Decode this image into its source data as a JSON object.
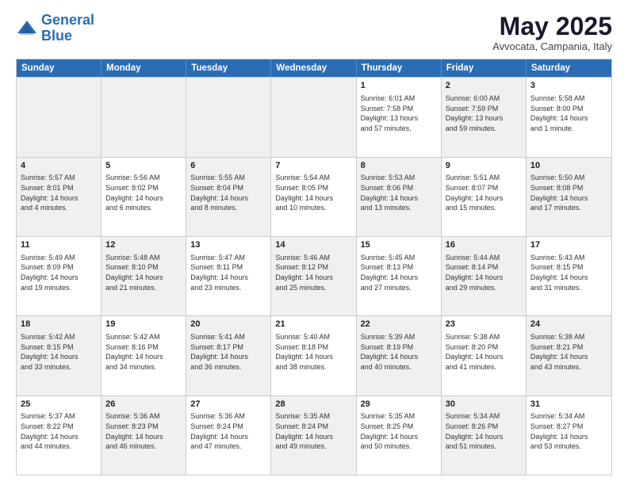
{
  "logo": {
    "line1": "General",
    "line2": "Blue"
  },
  "title": {
    "month_year": "May 2025",
    "location": "Avvocata, Campania, Italy"
  },
  "weekdays": [
    "Sunday",
    "Monday",
    "Tuesday",
    "Wednesday",
    "Thursday",
    "Friday",
    "Saturday"
  ],
  "rows": [
    [
      {
        "day": "",
        "info": "",
        "shaded": true
      },
      {
        "day": "",
        "info": "",
        "shaded": true
      },
      {
        "day": "",
        "info": "",
        "shaded": true
      },
      {
        "day": "",
        "info": "",
        "shaded": true
      },
      {
        "day": "1",
        "info": "Sunrise: 6:01 AM\nSunset: 7:58 PM\nDaylight: 13 hours\nand 57 minutes."
      },
      {
        "day": "2",
        "info": "Sunrise: 6:00 AM\nSunset: 7:59 PM\nDaylight: 13 hours\nand 59 minutes.",
        "shaded": true
      },
      {
        "day": "3",
        "info": "Sunrise: 5:58 AM\nSunset: 8:00 PM\nDaylight: 14 hours\nand 1 minute."
      }
    ],
    [
      {
        "day": "4",
        "info": "Sunrise: 5:57 AM\nSunset: 8:01 PM\nDaylight: 14 hours\nand 4 minutes.",
        "shaded": true
      },
      {
        "day": "5",
        "info": "Sunrise: 5:56 AM\nSunset: 8:02 PM\nDaylight: 14 hours\nand 6 minutes."
      },
      {
        "day": "6",
        "info": "Sunrise: 5:55 AM\nSunset: 8:04 PM\nDaylight: 14 hours\nand 8 minutes.",
        "shaded": true
      },
      {
        "day": "7",
        "info": "Sunrise: 5:54 AM\nSunset: 8:05 PM\nDaylight: 14 hours\nand 10 minutes."
      },
      {
        "day": "8",
        "info": "Sunrise: 5:53 AM\nSunset: 8:06 PM\nDaylight: 14 hours\nand 13 minutes.",
        "shaded": true
      },
      {
        "day": "9",
        "info": "Sunrise: 5:51 AM\nSunset: 8:07 PM\nDaylight: 14 hours\nand 15 minutes."
      },
      {
        "day": "10",
        "info": "Sunrise: 5:50 AM\nSunset: 8:08 PM\nDaylight: 14 hours\nand 17 minutes.",
        "shaded": true
      }
    ],
    [
      {
        "day": "11",
        "info": "Sunrise: 5:49 AM\nSunset: 8:09 PM\nDaylight: 14 hours\nand 19 minutes."
      },
      {
        "day": "12",
        "info": "Sunrise: 5:48 AM\nSunset: 8:10 PM\nDaylight: 14 hours\nand 21 minutes.",
        "shaded": true
      },
      {
        "day": "13",
        "info": "Sunrise: 5:47 AM\nSunset: 8:11 PM\nDaylight: 14 hours\nand 23 minutes."
      },
      {
        "day": "14",
        "info": "Sunrise: 5:46 AM\nSunset: 8:12 PM\nDaylight: 14 hours\nand 25 minutes.",
        "shaded": true
      },
      {
        "day": "15",
        "info": "Sunrise: 5:45 AM\nSunset: 8:13 PM\nDaylight: 14 hours\nand 27 minutes."
      },
      {
        "day": "16",
        "info": "Sunrise: 5:44 AM\nSunset: 8:14 PM\nDaylight: 14 hours\nand 29 minutes.",
        "shaded": true
      },
      {
        "day": "17",
        "info": "Sunrise: 5:43 AM\nSunset: 8:15 PM\nDaylight: 14 hours\nand 31 minutes."
      }
    ],
    [
      {
        "day": "18",
        "info": "Sunrise: 5:42 AM\nSunset: 8:15 PM\nDaylight: 14 hours\nand 33 minutes.",
        "shaded": true
      },
      {
        "day": "19",
        "info": "Sunrise: 5:42 AM\nSunset: 8:16 PM\nDaylight: 14 hours\nand 34 minutes."
      },
      {
        "day": "20",
        "info": "Sunrise: 5:41 AM\nSunset: 8:17 PM\nDaylight: 14 hours\nand 36 minutes.",
        "shaded": true
      },
      {
        "day": "21",
        "info": "Sunrise: 5:40 AM\nSunset: 8:18 PM\nDaylight: 14 hours\nand 38 minutes."
      },
      {
        "day": "22",
        "info": "Sunrise: 5:39 AM\nSunset: 8:19 PM\nDaylight: 14 hours\nand 40 minutes.",
        "shaded": true
      },
      {
        "day": "23",
        "info": "Sunrise: 5:38 AM\nSunset: 8:20 PM\nDaylight: 14 hours\nand 41 minutes."
      },
      {
        "day": "24",
        "info": "Sunrise: 5:38 AM\nSunset: 8:21 PM\nDaylight: 14 hours\nand 43 minutes.",
        "shaded": true
      }
    ],
    [
      {
        "day": "25",
        "info": "Sunrise: 5:37 AM\nSunset: 8:22 PM\nDaylight: 14 hours\nand 44 minutes."
      },
      {
        "day": "26",
        "info": "Sunrise: 5:36 AM\nSunset: 8:23 PM\nDaylight: 14 hours\nand 46 minutes.",
        "shaded": true
      },
      {
        "day": "27",
        "info": "Sunrise: 5:36 AM\nSunset: 8:24 PM\nDaylight: 14 hours\nand 47 minutes."
      },
      {
        "day": "28",
        "info": "Sunrise: 5:35 AM\nSunset: 8:24 PM\nDaylight: 14 hours\nand 49 minutes.",
        "shaded": true
      },
      {
        "day": "29",
        "info": "Sunrise: 5:35 AM\nSunset: 8:25 PM\nDaylight: 14 hours\nand 50 minutes."
      },
      {
        "day": "30",
        "info": "Sunrise: 5:34 AM\nSunset: 8:26 PM\nDaylight: 14 hours\nand 51 minutes.",
        "shaded": true
      },
      {
        "day": "31",
        "info": "Sunrise: 5:34 AM\nSunset: 8:27 PM\nDaylight: 14 hours\nand 53 minutes."
      }
    ]
  ]
}
